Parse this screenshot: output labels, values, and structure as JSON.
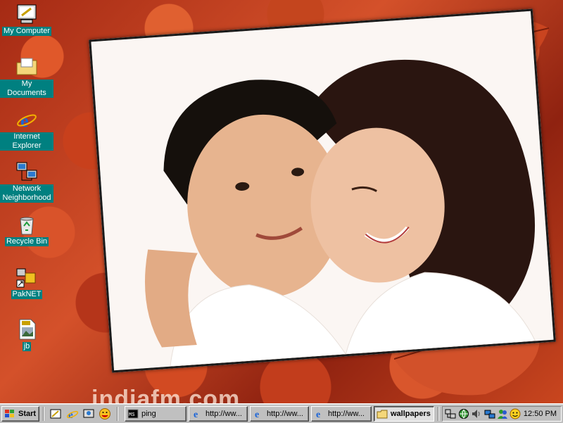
{
  "desktop": {
    "icons": [
      {
        "label": "My Computer",
        "icon": "my-computer-icon"
      },
      {
        "label": "My Documents",
        "icon": "folder-icon"
      },
      {
        "label": "Internet Explorer",
        "icon": "internet-explorer-icon"
      },
      {
        "label": "Network Neighborhood",
        "icon": "network-icon"
      },
      {
        "label": "Recycle Bin",
        "icon": "recycle-bin-icon"
      },
      {
        "label": "PakNET",
        "icon": "paknet-shortcut-icon"
      },
      {
        "label": "jb",
        "icon": "jpg-file-icon"
      }
    ],
    "wallpaper_text": "indiafm.com"
  },
  "taskbar": {
    "start_label": "Start",
    "quick_launch": [
      "show-desktop-icon",
      "internet-explorer-icon",
      "channels-icon",
      "messenger-icon"
    ],
    "tasks": [
      {
        "label": "ping",
        "icon": "msdos-icon",
        "active": false
      },
      {
        "label": "http://ww...",
        "icon": "internet-explorer-icon",
        "active": false
      },
      {
        "label": "http://ww...",
        "icon": "internet-explorer-icon",
        "active": false
      },
      {
        "label": "http://ww...",
        "icon": "internet-explorer-icon",
        "active": false
      },
      {
        "label": "wallpapers",
        "icon": "folder-icon",
        "active": true
      }
    ],
    "tray": {
      "icons": [
        "network-tray-icon",
        "globe-tray-icon",
        "speaker-icon",
        "connection-icon",
        "messenger-tray-icon",
        "smiley-icon"
      ],
      "clock": "12:50 PM"
    }
  },
  "colors": {
    "label_bg": "#008080",
    "taskbar": "#c0c0c0",
    "frame": "#fbf6f3"
  }
}
